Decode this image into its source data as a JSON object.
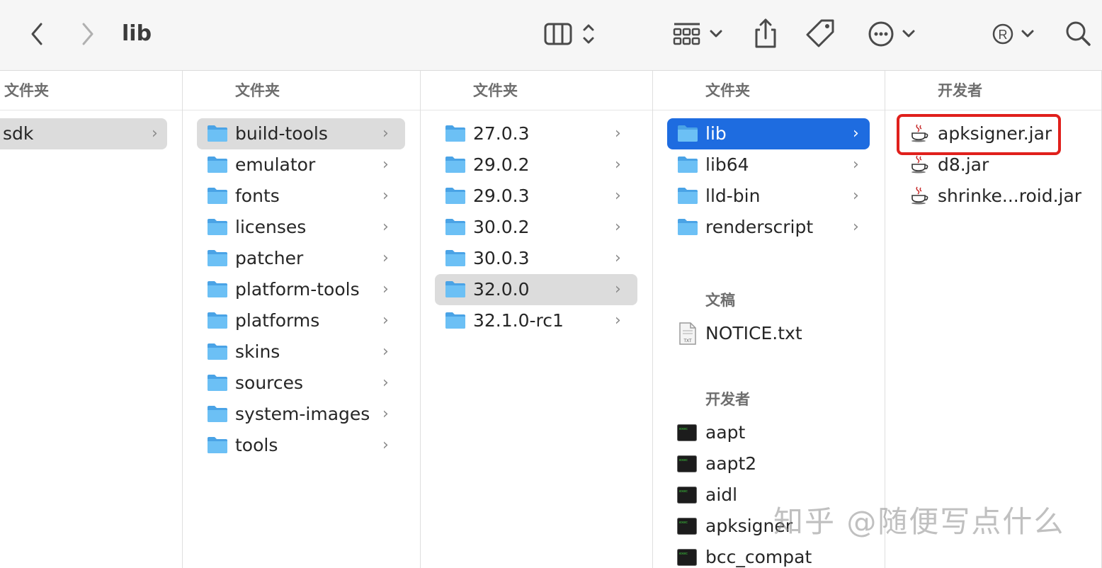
{
  "window": {
    "title": "lib"
  },
  "toolbar": {
    "back_icon": "chevron-left-icon",
    "forward_icon": "chevron-right-icon",
    "view_icon": "column-view-icon",
    "group_icon": "grid-group-icon",
    "share_icon": "share-icon",
    "tag_icon": "tag-icon",
    "more_icon": "ellipsis-circle-icon",
    "registered_icon": "registered-icon",
    "search_icon": "search-icon"
  },
  "columns": [
    {
      "header": "文件夹",
      "items": [
        {
          "label": "sdk",
          "kind": "text"
        }
      ]
    },
    {
      "header": "文件夹",
      "items": [
        {
          "label": "build-tools"
        },
        {
          "label": "emulator"
        },
        {
          "label": "fonts"
        },
        {
          "label": "licenses"
        },
        {
          "label": "patcher"
        },
        {
          "label": "platform-tools"
        },
        {
          "label": "platforms"
        },
        {
          "label": "skins"
        },
        {
          "label": "sources"
        },
        {
          "label": "system-images"
        },
        {
          "label": "tools"
        }
      ]
    },
    {
      "header": "文件夹",
      "items": [
        {
          "label": "27.0.3"
        },
        {
          "label": "29.0.2"
        },
        {
          "label": "29.0.3"
        },
        {
          "label": "30.0.2"
        },
        {
          "label": "30.0.3"
        },
        {
          "label": "32.0.0"
        },
        {
          "label": "32.1.0-rc1"
        }
      ]
    },
    {
      "header": "文件夹",
      "folders": [
        {
          "label": "lib"
        },
        {
          "label": "lib64"
        },
        {
          "label": "lld-bin"
        },
        {
          "label": "renderscript"
        }
      ],
      "docs_title": "文稿",
      "docs": [
        {
          "label": "NOTICE.txt"
        }
      ],
      "dev_title": "开发者",
      "dev": [
        {
          "label": "aapt"
        },
        {
          "label": "aapt2"
        },
        {
          "label": "aidl"
        },
        {
          "label": "apksigner"
        },
        {
          "label": "bcc_compat"
        }
      ]
    },
    {
      "header": "开发者",
      "items": [
        {
          "label": "apksigner.jar"
        },
        {
          "label": "d8.jar"
        },
        {
          "label": "shrinke...roid.jar"
        }
      ]
    }
  ],
  "chevron": "›",
  "watermark": "知乎 @随便写点什么",
  "colors": {
    "selection_blue": "#1e6ce0",
    "selection_gray": "#dcdcdc",
    "highlight_red": "#e0201c",
    "folder_blue": "#5db4ef"
  }
}
